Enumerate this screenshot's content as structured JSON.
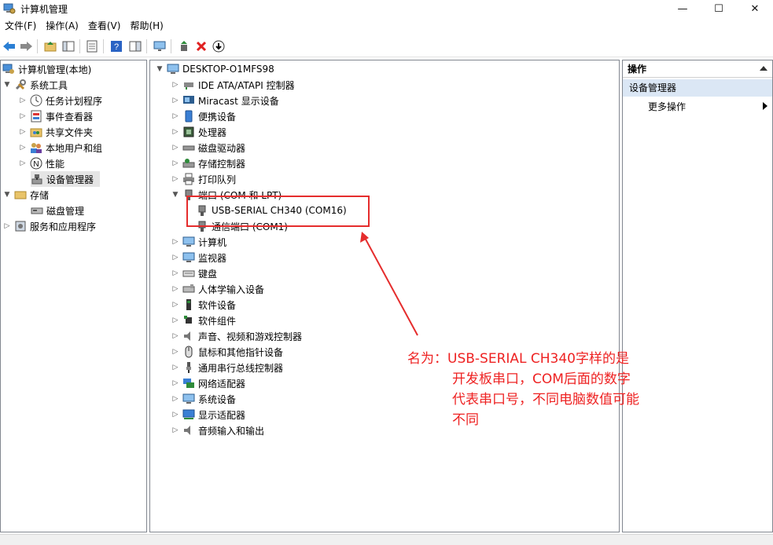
{
  "window": {
    "title": "计算机管理",
    "controls": [
      "—",
      "☐",
      "✕"
    ]
  },
  "menu": [
    "文件(F)",
    "操作(A)",
    "查看(V)",
    "帮助(H)"
  ],
  "left_tree": {
    "root": "计算机管理(本地)",
    "system_tools": "系统工具",
    "system_children": [
      "任务计划程序",
      "事件查看器",
      "共享文件夹",
      "本地用户和组",
      "性能",
      "设备管理器"
    ],
    "storage": "存储",
    "storage_children": [
      "磁盘管理"
    ],
    "services": "服务和应用程序"
  },
  "device_tree": {
    "computer_name": "DESKTOP-O1MFS98",
    "categories_before": [
      "IDE ATA/ATAPI 控制器",
      "Miracast 显示设备",
      "便携设备",
      "处理器",
      "磁盘驱动器",
      "存储控制器",
      "打印队列"
    ],
    "ports_category": "端口 (COM 和 LPT)",
    "ports_children": [
      "USB-SERIAL CH340 (COM16)",
      "通信端口 (COM1)"
    ],
    "categories_after": [
      "计算机",
      "监视器",
      "键盘",
      "人体学输入设备",
      "软件设备",
      "软件组件",
      "声音、视频和游戏控制器",
      "鼠标和其他指针设备",
      "通用串行总线控制器",
      "网络适配器",
      "系统设备",
      "显示适配器",
      "音频输入和输出"
    ]
  },
  "actions": {
    "header": "操作",
    "section": "设备管理器",
    "more": "更多操作"
  },
  "annotation": {
    "line1": "名为：USB-SERIAL CH340字样的是",
    "line2": "开发板串口，COM后面的数字",
    "line3": "代表串口号，不同电脑数值可能",
    "line4": "不同",
    "color": "#ee2222"
  }
}
